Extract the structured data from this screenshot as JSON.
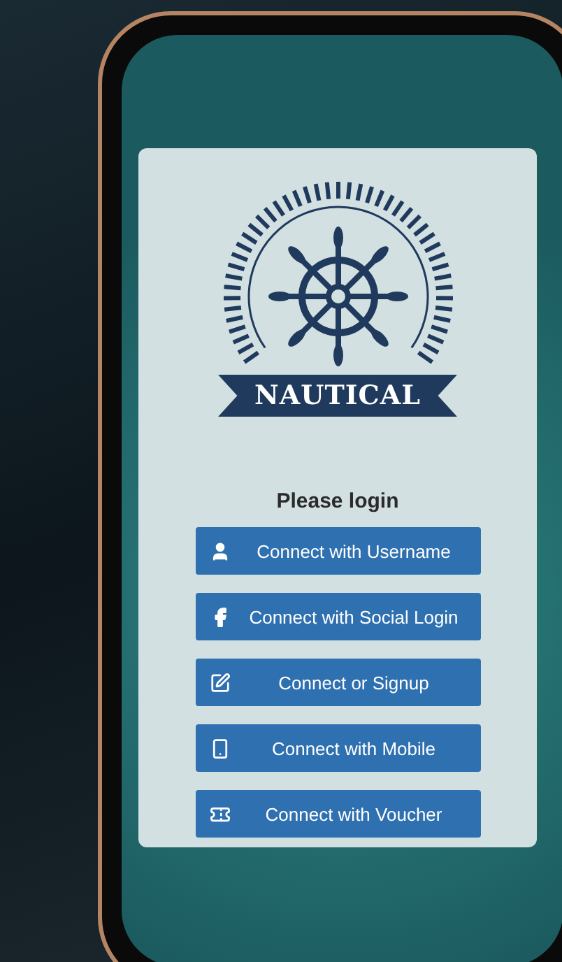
{
  "logo": {
    "text": "NAUTICAL"
  },
  "heading": "Please login",
  "buttons": [
    {
      "label": "Connect with Username",
      "kind": "user"
    },
    {
      "label": "Connect with Social Login",
      "kind": "facebook"
    },
    {
      "label": "Connect or Signup",
      "kind": "edit"
    },
    {
      "label": "Connect with Mobile",
      "kind": "mobile"
    },
    {
      "label": "Connect with Voucher",
      "kind": "voucher"
    }
  ]
}
